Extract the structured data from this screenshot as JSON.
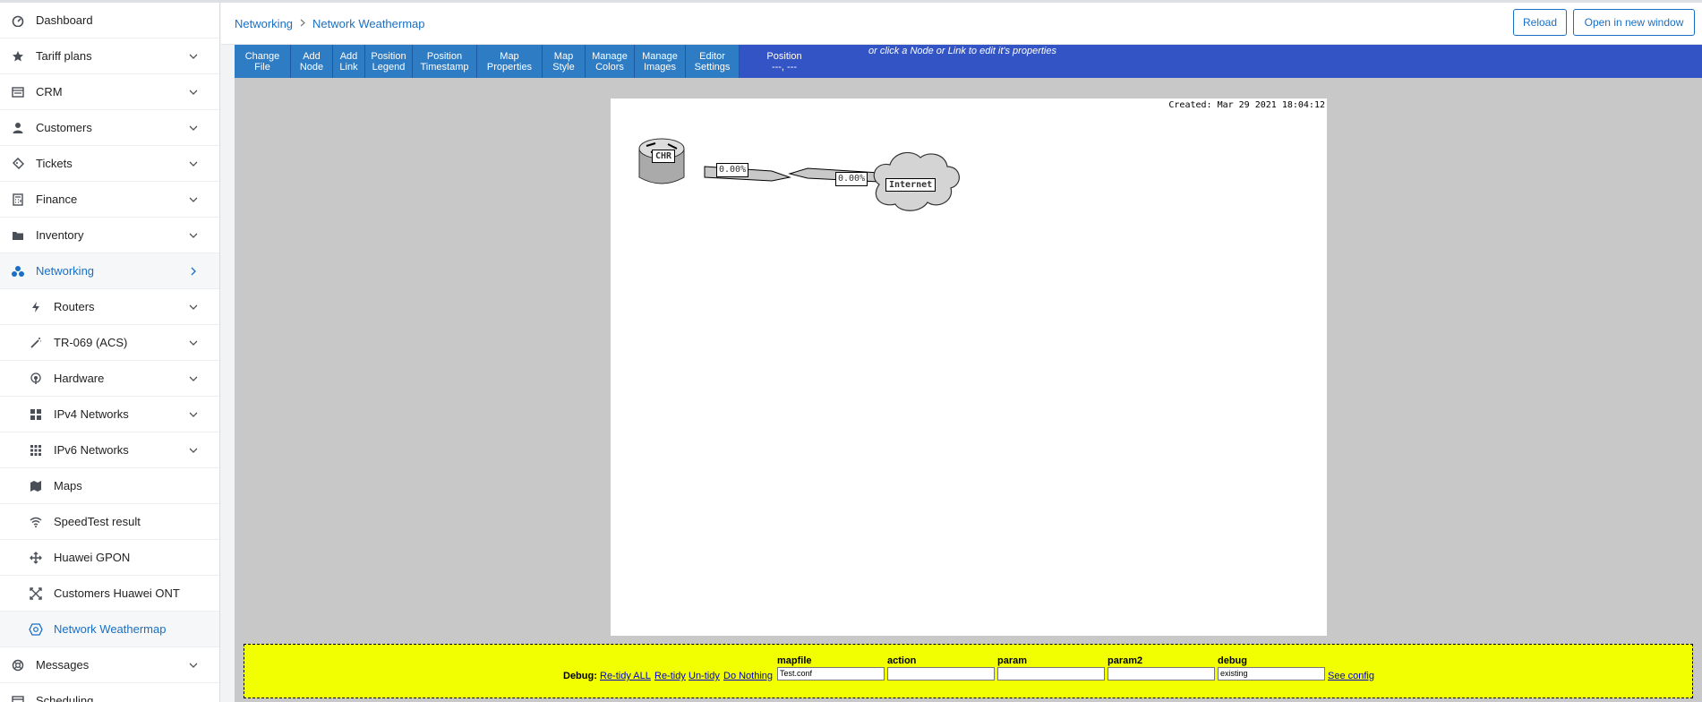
{
  "sidebar": {
    "items": [
      {
        "label": "Dashboard",
        "icon": "dashboard-icon"
      },
      {
        "label": "Tariff plans",
        "icon": "star-icon"
      },
      {
        "label": "CRM",
        "icon": "crm-icon"
      },
      {
        "label": "Customers",
        "icon": "user-icon"
      },
      {
        "label": "Tickets",
        "icon": "ticket-icon"
      },
      {
        "label": "Finance",
        "icon": "calculator-icon"
      },
      {
        "label": "Inventory",
        "icon": "folder-icon"
      },
      {
        "label": "Networking",
        "icon": "network-icon"
      },
      {
        "label": "Routers",
        "icon": "bolt-icon"
      },
      {
        "label": "TR-069 (ACS)",
        "icon": "wand-icon"
      },
      {
        "label": "Hardware",
        "icon": "broadcast-icon"
      },
      {
        "label": "IPv4 Networks",
        "icon": "grid-icon"
      },
      {
        "label": "IPv6 Networks",
        "icon": "grid-dots-icon"
      },
      {
        "label": "Maps",
        "icon": "map-icon"
      },
      {
        "label": "SpeedTest result",
        "icon": "wifi-icon"
      },
      {
        "label": "Huawei GPON",
        "icon": "arrows-icon"
      },
      {
        "label": "Customers Huawei ONT",
        "icon": "expand-icon"
      },
      {
        "label": "Network Weathermap",
        "icon": "hexagon-icon"
      },
      {
        "label": "Messages",
        "icon": "lifebuoy-icon"
      },
      {
        "label": "Scheduling",
        "icon": "calendar-icon"
      }
    ]
  },
  "header": {
    "breadcrumb": [
      "Networking",
      "Network Weathermap"
    ],
    "reload_label": "Reload",
    "open_label": "Open in new window"
  },
  "toolbar": {
    "buttons": [
      "Change\nFile",
      "Add\nNode",
      "Add\nLink",
      "Position\nLegend",
      "Position\nTimestamp",
      "Map\nProperties",
      "Map\nStyle",
      "Manage\nColors",
      "Manage\nImages",
      "Editor\nSettings"
    ],
    "position_label": "Position\n---, ---",
    "hint": "or click a Node or Link to edit it's properties"
  },
  "map": {
    "created": "Created: Mar 29 2021 18:04:12",
    "node_router": "CHR",
    "node_cloud": "Internet",
    "link_out": "0.00%",
    "link_in": "0.00%"
  },
  "debug": {
    "label": "Debug:",
    "links": [
      "Re-tidy ALL",
      "Re-tidy",
      "Un-tidy",
      "Do Nothing"
    ],
    "headers": [
      "mapfile",
      "action",
      "param",
      "param2",
      "debug"
    ],
    "values": [
      "Test.conf",
      "",
      "",
      "",
      "existing"
    ],
    "see_config": "See config"
  },
  "colors": {
    "accent": "#1a6fc4",
    "toolbar": "#3354c4",
    "toolbar_button": "#2e7cc4",
    "debug_bg": "#f2ff00"
  }
}
